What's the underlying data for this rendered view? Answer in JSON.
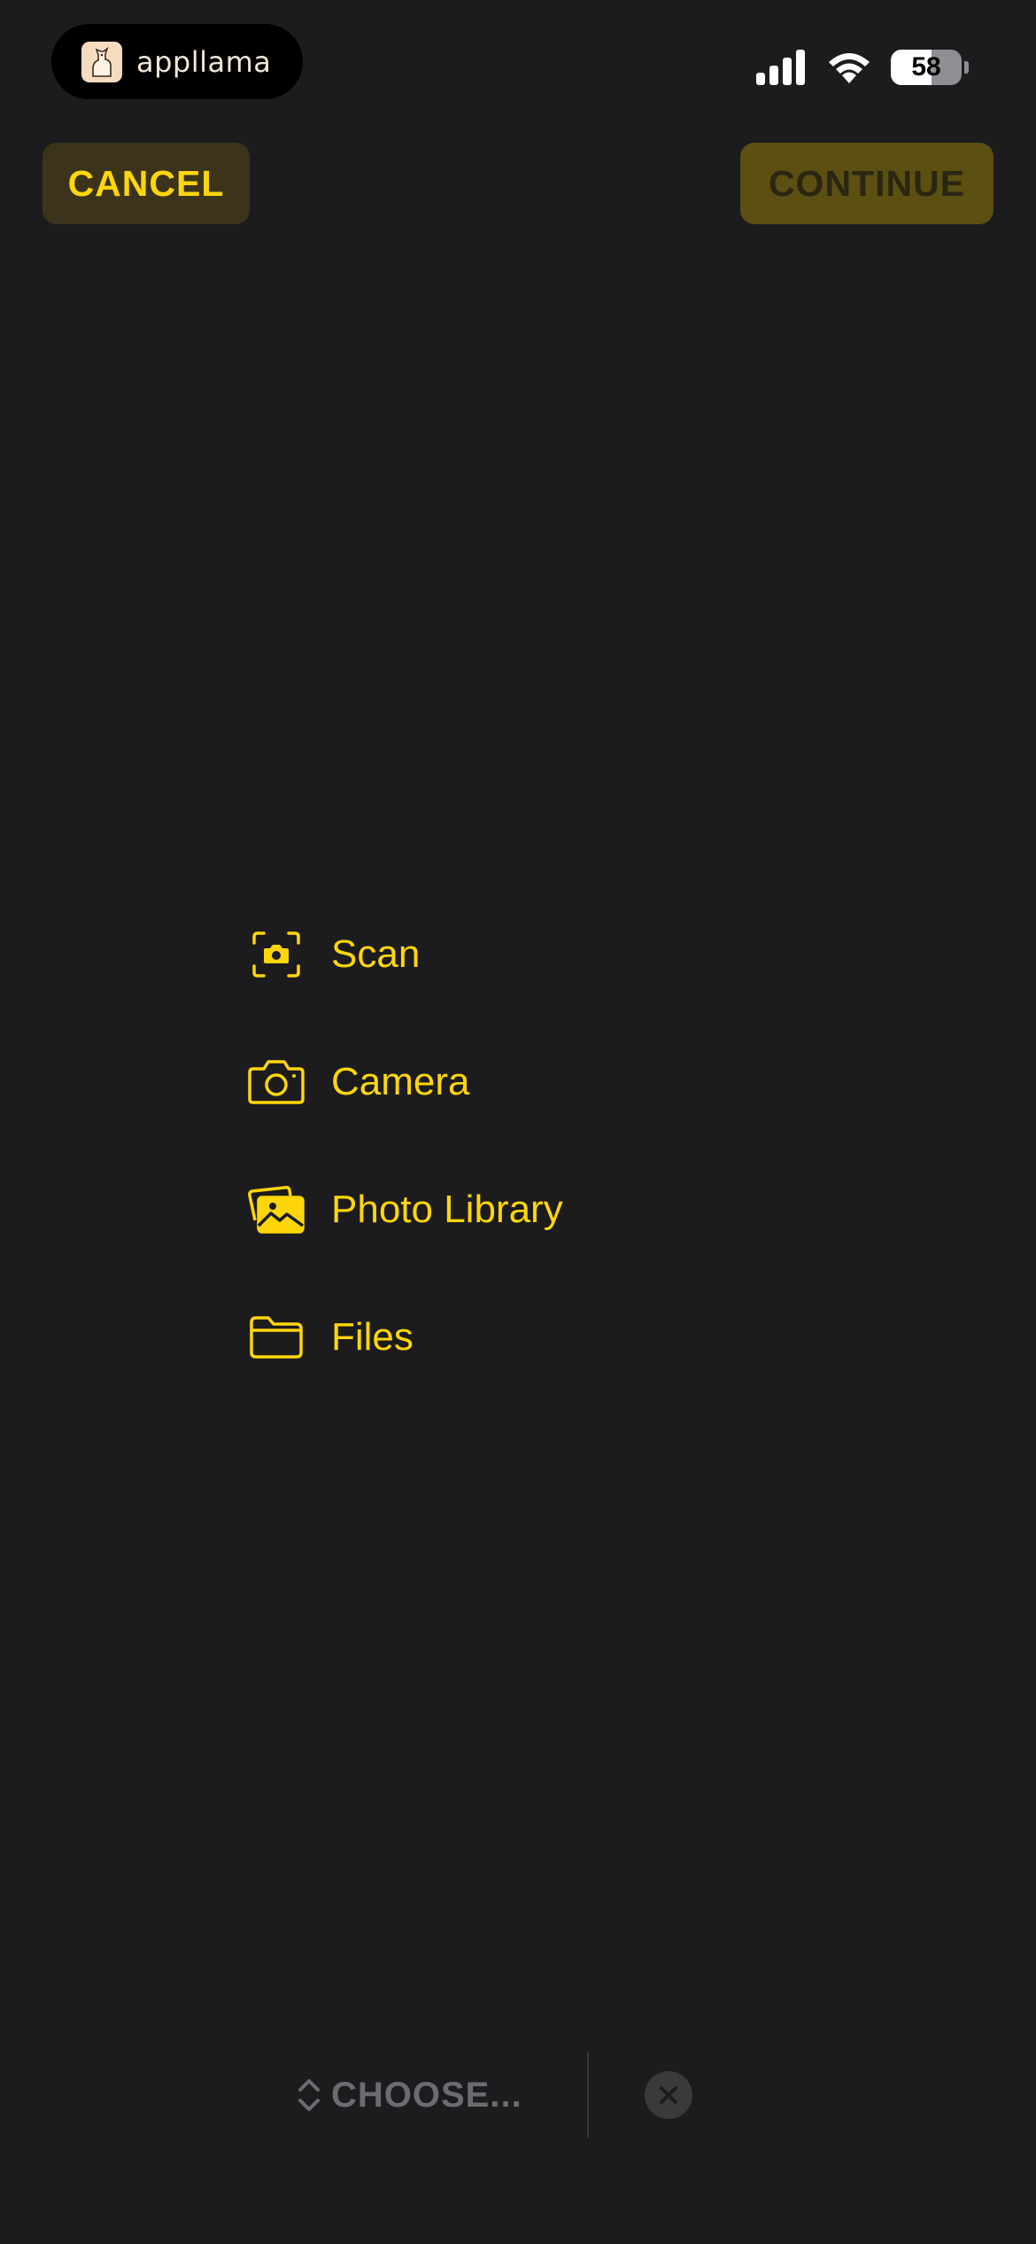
{
  "status_bar": {
    "app_name": "appllama",
    "battery_percent": 58,
    "battery_text": "58"
  },
  "toolbar": {
    "cancel_label": "CANCEL",
    "continue_label": "CONTINUE"
  },
  "menu": {
    "items": [
      {
        "label": "Scan",
        "icon": "scan-camera-icon"
      },
      {
        "label": "Camera",
        "icon": "camera-icon"
      },
      {
        "label": "Photo Library",
        "icon": "photo-library-icon"
      },
      {
        "label": "Files",
        "icon": "folder-icon"
      }
    ]
  },
  "bottom_bar": {
    "choose_label": "CHOOSE..."
  },
  "colors": {
    "background": "#1c1c1e",
    "accent": "#ffd60a",
    "cancel_bg": "#3b341b",
    "continue_bg": "#5b4f12",
    "muted": "#6b6b70"
  }
}
